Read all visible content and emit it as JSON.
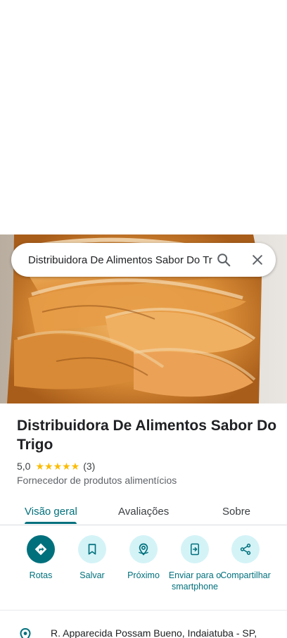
{
  "search": {
    "value": "Distribuidora De Alimentos Sabor Do Trigo"
  },
  "place": {
    "name": "Distribuidora De Alimentos Sabor Do Trigo",
    "rating": "5,0",
    "stars": "★★★★★",
    "review_count": "(3)",
    "category": "Fornecedor de produtos alimentícios"
  },
  "tabs": [
    {
      "label": "Visão geral",
      "active": true
    },
    {
      "label": "Avaliações",
      "active": false
    },
    {
      "label": "Sobre",
      "active": false
    }
  ],
  "actions": [
    {
      "label": "Rotas",
      "icon": "directions-icon"
    },
    {
      "label": "Salvar",
      "icon": "bookmark-icon"
    },
    {
      "label": "Próximo",
      "icon": "nearby-icon"
    },
    {
      "label": "Enviar para o smartphone",
      "icon": "send-to-phone-icon"
    },
    {
      "label": "Compartilhar",
      "icon": "share-icon"
    }
  ],
  "address": {
    "text": "R. Apparecida Possam Bueno, Indaiatuba - SP,"
  },
  "colors": {
    "accent": "#00707c",
    "action_bg": "#d4f3f7",
    "star": "#fbbc04"
  }
}
